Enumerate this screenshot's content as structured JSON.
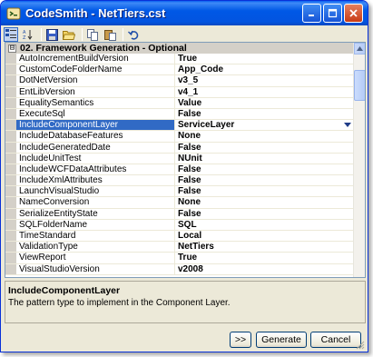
{
  "window": {
    "title": "CodeSmith - NetTiers.cst"
  },
  "toolbar": {
    "icons": [
      "categorized-icon",
      "alphabetical-icon",
      "save-icon",
      "open-icon",
      "copy-icon",
      "paste-icon",
      "undo-icon"
    ]
  },
  "grid": {
    "category": {
      "expander": "⊟",
      "label": "02. Framework Generation - Optional"
    },
    "rows": [
      {
        "name": "AutoIncrementBuildVersion",
        "value": "True"
      },
      {
        "name": "CustomCodeFolderName",
        "value": "App_Code"
      },
      {
        "name": "DotNetVersion",
        "value": "v3_5"
      },
      {
        "name": "EntLibVersion",
        "value": "v4_1"
      },
      {
        "name": "EqualitySemantics",
        "value": "Value"
      },
      {
        "name": "ExecuteSql",
        "value": "False"
      },
      {
        "name": "IncludeComponentLayer",
        "value": "ServiceLayer"
      },
      {
        "name": "IncludeDatabaseFeatures",
        "value": "None"
      },
      {
        "name": "IncludeGeneratedDate",
        "value": "False"
      },
      {
        "name": "IncludeUnitTest",
        "value": "NUnit"
      },
      {
        "name": "IncludeWCFDataAttributes",
        "value": "False"
      },
      {
        "name": "IncludeXmlAttributes",
        "value": "False"
      },
      {
        "name": "LaunchVisualStudio",
        "value": "False"
      },
      {
        "name": "NameConversion",
        "value": "None"
      },
      {
        "name": "SerializeEntityState",
        "value": "False"
      },
      {
        "name": "SQLFolderName",
        "value": "SQL"
      },
      {
        "name": "TimeStandard",
        "value": "Local"
      },
      {
        "name": "ValidationType",
        "value": "NetTiers"
      },
      {
        "name": "ViewReport",
        "value": "True"
      },
      {
        "name": "VisualStudioVersion",
        "value": "v2008"
      }
    ],
    "selected_index": 6
  },
  "help": {
    "title": "IncludeComponentLayer",
    "description": "The pattern type to implement in the Component Layer."
  },
  "buttons": {
    "more": ">>",
    "generate": "Generate",
    "cancel": "Cancel"
  },
  "colors": {
    "selection": "#316ac5",
    "titlebar": "#0058e6"
  }
}
